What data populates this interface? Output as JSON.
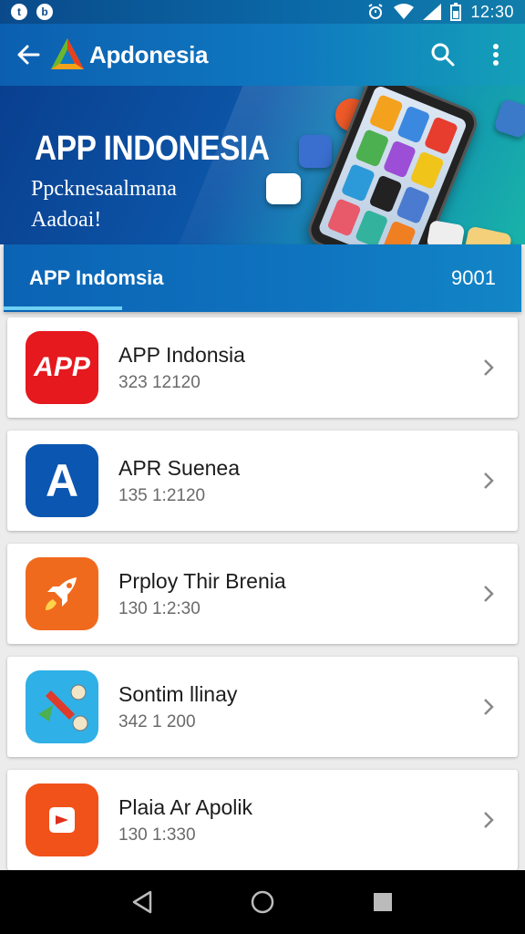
{
  "status_bar": {
    "time": "12:30",
    "left_icons": [
      "notification-t-icon",
      "notification-b-icon"
    ],
    "right_icons": [
      "alarm-icon",
      "wifi-icon",
      "signal-icon",
      "battery-icon"
    ]
  },
  "app_bar": {
    "title": "Apdonesia"
  },
  "banner": {
    "title": "APP INDONESIA",
    "subtitle_line1": "Ppcknesaalmana",
    "subtitle_line2": "Aadoai!"
  },
  "section": {
    "title": "APP Indomsia",
    "count": "9001"
  },
  "apps": [
    {
      "name": "APP Indonsia",
      "meta": "323 12120",
      "icon_text": "APP",
      "icon": "app-text-icon",
      "color": "#e5191e"
    },
    {
      "name": "APR Suenea",
      "meta": "135 1:2120",
      "icon_text": "A",
      "icon": "letter-a-icon",
      "color": "#0b56b0"
    },
    {
      "name": "Prploy Thir Brenia",
      "meta": "130 1:2:30",
      "icon_text": "",
      "icon": "rocket-icon",
      "color": "#f06a1e"
    },
    {
      "name": "Sontim llinay",
      "meta": "342 1 200",
      "icon_text": "",
      "icon": "arrow-tools-icon",
      "color": "#2fb0e6"
    },
    {
      "name": "Plaia Ar Apolik",
      "meta": "130 1:330",
      "icon_text": "",
      "icon": "cart-icon",
      "color": "#f0521a"
    }
  ],
  "colors": {
    "primary": "#0c5fb0",
    "accent": "#6dd0f5"
  }
}
